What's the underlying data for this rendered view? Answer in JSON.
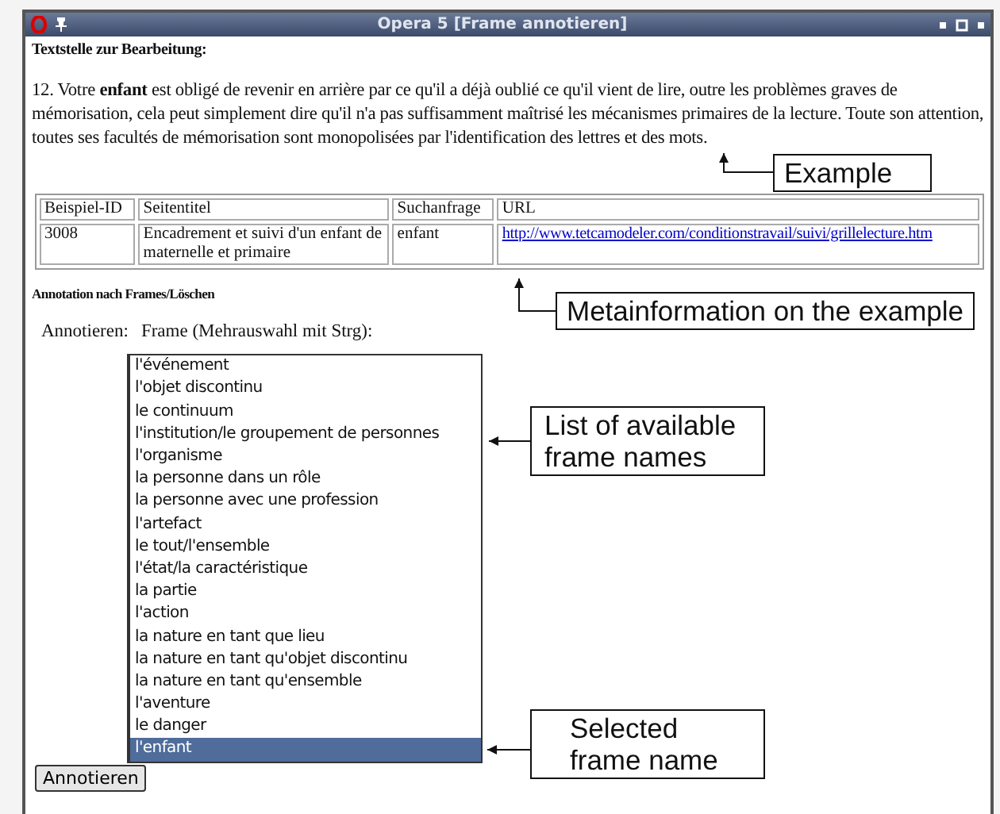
{
  "window": {
    "title": "Opera 5 [Frame annotieren]"
  },
  "heading": "Textstelle zur Bearbeitung:",
  "passage": "12. Votre **enfant** est obligé de revenir en arrière par ce qu'il a déjà oublié ce qu'il vient de lire, outre les problèmes graves de mémorisation, cela peut simplement dire qu'il n'a pas suffisamment maîtrisé les mécanismes primaires de la lecture. Toute son attention, toutes ses facultés de mémorisation sont monopolisées par l'identification des lettres et des mots.",
  "table": {
    "columns": [
      "Beispiel-ID",
      "Seitentitel",
      "Suchanfrage",
      "URL"
    ],
    "rows": [
      {
        "id": "3008",
        "title": "Encadrement et suivi d'un enfant de maternelle et primaire",
        "query": "enfant",
        "url": "http://www.tetcamodeler.com/conditionstravail/suivi/grillelecture.htm"
      }
    ]
  },
  "section_heading": "Annotation nach Frames/Löschen",
  "field_label": "Annotieren:",
  "list_label": "Frame (Mehrauswahl mit Strg):",
  "frames": [
    {
      "label": "l'événement",
      "selected": false
    },
    {
      "label": "l'objet discontinu",
      "selected": false
    },
    {
      "label": "le continuum",
      "selected": false
    },
    {
      "label": "l'institution/le groupement de personnes",
      "selected": false
    },
    {
      "label": "l'organisme",
      "selected": false
    },
    {
      "label": "la personne dans un rôle",
      "selected": false
    },
    {
      "label": "la personne avec une profession",
      "selected": false
    },
    {
      "label": "l'artefact",
      "selected": false
    },
    {
      "label": "le tout/l'ensemble",
      "selected": false
    },
    {
      "label": "l'état/la caractéristique",
      "selected": false
    },
    {
      "label": "la partie",
      "selected": false
    },
    {
      "label": "l'action",
      "selected": false
    },
    {
      "label": "la nature en tant que lieu",
      "selected": false
    },
    {
      "label": "la nature en tant qu'objet discontinu",
      "selected": false
    },
    {
      "label": "la nature en tant qu'ensemble",
      "selected": false
    },
    {
      "label": "l'aventure",
      "selected": false
    },
    {
      "label": "le danger",
      "selected": false
    },
    {
      "label": "l'enfant",
      "selected": true
    }
  ],
  "button": "Annotieren",
  "callouts": [
    {
      "text": "Example"
    },
    {
      "text": "Metainformation on the example"
    },
    {
      "text": "List of available frame names"
    },
    {
      "text": "Selected frame name"
    }
  ]
}
